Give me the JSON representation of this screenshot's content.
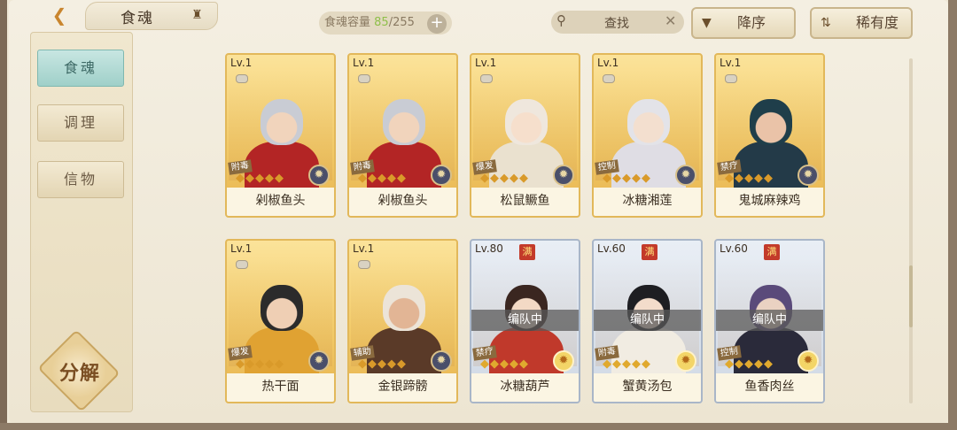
{
  "header": {
    "back_icon": "back-arrow-icon",
    "title": "食魂",
    "crown_icon": "crown-icon",
    "capacity_label": "食魂容量",
    "capacity_current": "85",
    "capacity_sep_total": "/255",
    "capacity_plus": "+",
    "search_placeholder": "查找",
    "search_clear": "✕",
    "sort_desc_label": "降序",
    "sort_rarity_label": "稀有度"
  },
  "sidebar": {
    "tabs": [
      {
        "label": "食魂",
        "active": true
      },
      {
        "label": "调理",
        "active": false
      },
      {
        "label": "信物",
        "active": false
      }
    ],
    "decompose_label": "分解"
  },
  "cards": [
    {
      "level": "Lv.1",
      "role": "附毒",
      "name": "剁椒鱼头",
      "stars": "◆◆◆◆◆",
      "badge": "✹",
      "team": "",
      "full": false,
      "theme": "gold",
      "skin": "#f1d4bc",
      "hair": "#c9ccd4",
      "outfit": "#b32525"
    },
    {
      "level": "Lv.1",
      "role": "附毒",
      "name": "剁椒鱼头",
      "stars": "◆◆◆◆◆",
      "badge": "✹",
      "team": "",
      "full": false,
      "theme": "gold",
      "skin": "#f1d4bc",
      "hair": "#c9ccd4",
      "outfit": "#b32525"
    },
    {
      "level": "Lv.1",
      "role": "爆发",
      "name": "松鼠鳜鱼",
      "stars": "◆◆◆◆◆",
      "badge": "✹",
      "team": "",
      "full": false,
      "theme": "gold",
      "skin": "#f6dfcc",
      "hair": "#efe7dd",
      "outfit": "#eae1cf"
    },
    {
      "level": "Lv.1",
      "role": "控制",
      "name": "冰糖湘莲",
      "stars": "◆◆◆◆◆",
      "badge": "✹",
      "team": "",
      "full": false,
      "theme": "gold",
      "skin": "#f3dfcf",
      "hair": "#e3e3e8",
      "outfit": "#dfdde4"
    },
    {
      "level": "Lv.1",
      "role": "禁疗",
      "name": "鬼城麻辣鸡",
      "stars": "◆◆◆◆◆",
      "badge": "✹",
      "team": "",
      "full": false,
      "theme": "gold",
      "skin": "#eac3a8",
      "hair": "#1f3e4a",
      "outfit": "#233a48"
    },
    {
      "level": "Lv.1",
      "role": "爆发",
      "name": "热干面",
      "stars": "◆◆◆◆◆",
      "badge": "✹",
      "team": "",
      "full": false,
      "theme": "gold",
      "skin": "#efcfb4",
      "hair": "#2b2b2b",
      "outfit": "#e0a232"
    },
    {
      "level": "Lv.1",
      "role": "辅助",
      "name": "金银蹄髈",
      "stars": "◆◆◆◆◆",
      "badge": "✹",
      "team": "",
      "full": false,
      "theme": "gold",
      "skin": "#e2b595",
      "hair": "#ece4d8",
      "outfit": "#5a3a28"
    },
    {
      "level": "Lv.80",
      "role": "禁疗",
      "name": "冰糖葫芦",
      "stars": "◆◆◆◆◆",
      "badge": "✹",
      "team": "编队中",
      "full": true,
      "theme": "blue",
      "skin": "#f3d9c5",
      "hair": "#3a2620",
      "outfit": "#c0392b"
    },
    {
      "level": "Lv.60",
      "role": "附毒",
      "name": "蟹黄汤包",
      "stars": "◆◆◆◆◆",
      "badge": "✹",
      "team": "编队中",
      "full": true,
      "theme": "blue",
      "skin": "#f3dccb",
      "hair": "#1e1e22",
      "outfit": "#f1ece2"
    },
    {
      "level": "Lv.60",
      "role": "控制",
      "name": "鱼香肉丝",
      "stars": "◆◆◆◆◆",
      "badge": "✹",
      "team": "编队中",
      "full": true,
      "theme": "blue",
      "skin": "#ead2c2",
      "hair": "#5a4a7a",
      "outfit": "#2a2a3a"
    }
  ],
  "full_label": "满"
}
